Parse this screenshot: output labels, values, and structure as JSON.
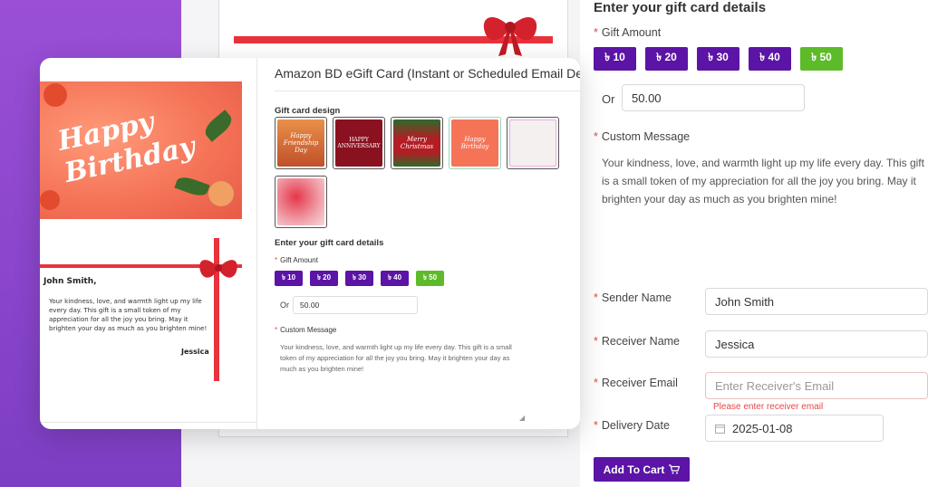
{
  "colors": {
    "brand_purple": "#5b14a5",
    "selected_green": "#5dbb2a",
    "ribbon_red": "#e8323c",
    "error_red": "#e54848"
  },
  "background_form": {
    "title": "Enter your gift card details",
    "gift_amount_label": "Gift Amount",
    "amounts": [
      "৳ 10",
      "৳ 20",
      "৳ 30",
      "৳ 40",
      "৳ 50"
    ],
    "selected_amount": "৳ 50",
    "or_label": "Or",
    "custom_amount_value": "50.00",
    "custom_message_label": "Custom Message",
    "custom_message_text": "Your kindness, love, and warmth light up my life every day. This gift is a small token of my appreciation for all the joy you bring. May it brighten your day as much as you brighten mine!",
    "sender_name_label": "Sender Name",
    "sender_name_value": "John Smith",
    "receiver_name_label": "Receiver Name",
    "receiver_name_value": "Jessica",
    "receiver_email_label": "Receiver Email",
    "receiver_email_placeholder": "Enter Receiver's Email",
    "receiver_email_error": "Please enter receiver email",
    "delivery_date_label": "Delivery Date",
    "delivery_date_value": "2025-01-08",
    "add_to_cart_label": "Add To Cart",
    "cart_icon": "cart-icon"
  },
  "front_card": {
    "product_title": "Amazon BD eGift Card (Instant or Scheduled Email De",
    "gift_card_design_label": "Gift card design",
    "designs": [
      "friendship-day",
      "happy-anniversary",
      "merry-christmas",
      "happy-birthday",
      "floral-white",
      "hearts-love"
    ],
    "selected_design": "happy-birthday",
    "design_thumb_text": {
      "friendship": "Happy Friendship Day",
      "anniversary": "HAPPY ANNIVERSARY",
      "christmas": "Merry Christmas",
      "birthday": "Happy Birthday"
    },
    "details_label": "Enter your gift card details",
    "gift_amount_label": "Gift Amount",
    "amounts": [
      "৳ 10",
      "৳ 20",
      "৳ 30",
      "৳ 40",
      "৳ 50"
    ],
    "or_label": "Or",
    "custom_amount_value": "50.00",
    "custom_message_label": "Custom Message",
    "custom_message_text": "Your kindness, love, and warmth light up my life every day. This gift is a small token of my appreciation for all the joy you bring. May it brighten your day as much as you brighten mine!"
  },
  "preview": {
    "headline": "Happy Birthday",
    "to_name": "John Smith,",
    "message": "Your kindness, love, and warmth light up my life every day. This gift is a small token of my appreciation for all the joy you bring. May it brighten your day as much as you brighten mine!",
    "from_name": "Jessica"
  }
}
